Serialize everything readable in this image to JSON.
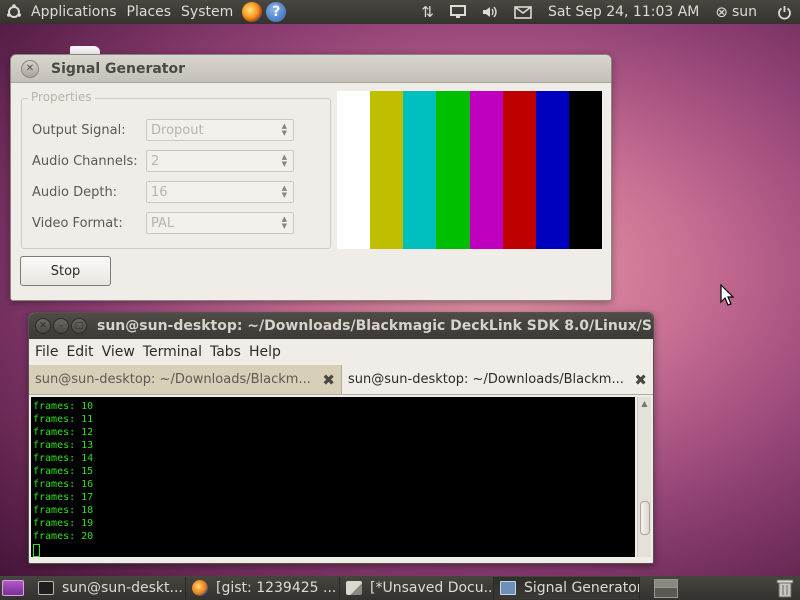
{
  "top_panel": {
    "menus": [
      "Applications",
      "Places",
      "System"
    ],
    "clock": "Sat Sep 24, 11:03 AM",
    "user": "sun"
  },
  "signal_generator": {
    "title": "Signal Generator",
    "properties_label": "Properties",
    "rows": [
      {
        "label": "Output Signal:",
        "value": "Dropout"
      },
      {
        "label": "Audio Channels:",
        "value": "2"
      },
      {
        "label": "Audio Depth:",
        "value": "16"
      },
      {
        "label": "Video Format:",
        "value": "PAL"
      }
    ],
    "color_bars": [
      "#ffffff",
      "#bfbf00",
      "#00bfbf",
      "#00bf00",
      "#bf00bf",
      "#bf0000",
      "#0000bf",
      "#000000"
    ],
    "stop_label": "Stop"
  },
  "terminal": {
    "title": "sun@sun-desktop: ~/Downloads/Blackmagic DeckLink SDK 8.0/Linux/S",
    "menus": [
      "File",
      "Edit",
      "View",
      "Terminal",
      "Tabs",
      "Help"
    ],
    "tabs": [
      {
        "label": "sun@sun-desktop: ~/Downloads/Blackm...",
        "active": false
      },
      {
        "label": "sun@sun-desktop: ~/Downloads/Blackm...",
        "active": true
      }
    ],
    "output": [
      "frames: 10",
      "frames: 11",
      "frames: 12",
      "frames: 13",
      "frames: 14",
      "frames: 15",
      "frames: 16",
      "frames: 17",
      "frames: 18",
      "frames: 19",
      "frames: 20"
    ],
    "text_color": "#33e022"
  },
  "taskbar": {
    "tasks": [
      {
        "label": "sun@sun-deskt...",
        "icon": "terminal-icon"
      },
      {
        "label": "[gist: 1239425 ...",
        "icon": "firefox-icon"
      },
      {
        "label": "[*Unsaved Docu...",
        "icon": "text-editor-icon"
      },
      {
        "label": "Signal Generator",
        "icon": "signal-generator-icon",
        "active": true
      }
    ]
  }
}
